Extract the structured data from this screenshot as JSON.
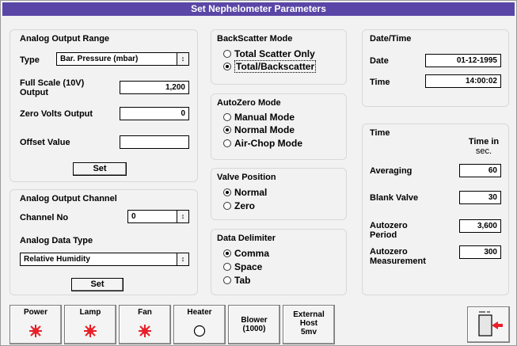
{
  "window": {
    "title": "Set Nephelometer Parameters"
  },
  "analog_output_range": {
    "title": "Analog Output Range",
    "type_label": "Type",
    "type_value": "Bar. Pressure (mbar)",
    "full_scale_label_1": "Full Scale (10V)",
    "full_scale_label_2": "Output",
    "full_scale_value": "1,200",
    "zero_volts_label": "Zero Volts Output",
    "zero_volts_value": "0",
    "offset_label": "Offset Value",
    "offset_value": "",
    "set_label": "Set"
  },
  "analog_output_channel": {
    "title": "Analog Output Channel",
    "channel_label": "Channel No",
    "channel_value": "0",
    "data_type_label": "Analog Data Type",
    "data_type_value": "Relative Humidity",
    "set_label": "Set"
  },
  "backscatter_mode": {
    "title": "BackScatter Mode",
    "options": [
      {
        "label": "Total Scatter Only",
        "selected": false
      },
      {
        "label": "Total/Backscatter",
        "selected": true
      }
    ]
  },
  "autozero_mode": {
    "title": "AutoZero Mode",
    "options": [
      {
        "label": "Manual Mode",
        "selected": false
      },
      {
        "label": "Normal Mode",
        "selected": true
      },
      {
        "label": "Air-Chop Mode",
        "selected": false
      }
    ]
  },
  "valve_position": {
    "title": "Valve Position",
    "options": [
      {
        "label": "Normal",
        "selected": true
      },
      {
        "label": "Zero",
        "selected": false
      }
    ]
  },
  "data_delimiter": {
    "title": "Data Delimiter",
    "options": [
      {
        "label": "Comma",
        "selected": true
      },
      {
        "label": "Space",
        "selected": false
      },
      {
        "label": "Tab",
        "selected": false
      }
    ]
  },
  "date_time": {
    "title": "Date/Time",
    "date_label": "Date",
    "date_value": "01-12-1995",
    "time_label": "Time",
    "time_value": "14:00:02"
  },
  "time_settings": {
    "title": "Time",
    "column_header_1": "Time in",
    "column_header_2": "sec.",
    "averaging_label": "Averaging",
    "averaging_value": "60",
    "blank_valve_label": "Blank Valve",
    "blank_valve_value": "30",
    "autozero_period_label_1": "Autozero",
    "autozero_period_label_2": "Period",
    "autozero_period_value": "3,600",
    "autozero_measurement_label_1": "Autozero",
    "autozero_measurement_label_2": "Measurement",
    "autozero_measurement_value": "300"
  },
  "status_bar": {
    "power": "Power",
    "lamp": "Lamp",
    "fan": "Fan",
    "heater": "Heater",
    "blower_1": "Blower",
    "blower_2": "(1000)",
    "external_1": "External",
    "external_2": "Host",
    "external_3": "5mv",
    "indicator_color": "#e8202a"
  },
  "icons": {
    "exit": "exit-door-icon",
    "indicator": "red-starburst-icon",
    "combo_arrow": "spin-arrows-icon"
  }
}
